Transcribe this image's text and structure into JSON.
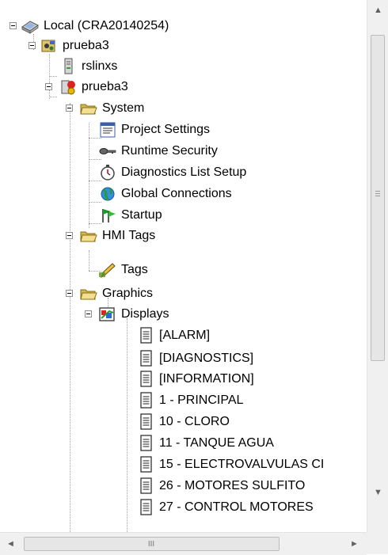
{
  "tree": {
    "root_label": "Local (CRA20140254)",
    "app_label": "prueba3",
    "server_label": "rslinxs",
    "hmi_label": "prueba3",
    "system_label": "System",
    "project_settings_label": "Project Settings",
    "runtime_security_label": "Runtime Security",
    "diagnostics_label": "Diagnostics List Setup",
    "global_connections_label": "Global Connections",
    "startup_label": "Startup",
    "hmi_tags_label": "HMI Tags",
    "tags_label": "Tags",
    "graphics_label": "Graphics",
    "displays_label": "Displays",
    "displays": [
      "[ALARM]",
      "[DIAGNOSTICS]",
      "[INFORMATION]",
      "1 - PRINCIPAL",
      "10 - CLORO",
      "11 - TANQUE AGUA",
      "15 - ELECTROVALVULAS CI",
      "26 - MOTORES SULFITO",
      "27 - CONTROL MOTORES"
    ]
  },
  "scrollbars": {
    "up_arrow": "▲",
    "down_arrow": "▼",
    "left_arrow": "◄",
    "right_arrow": "►",
    "h_grip": "III"
  },
  "colors": {
    "folder": "#e8d277",
    "scroll_bg": "#f0f0f0",
    "tree_line": "#a0a0a0"
  }
}
